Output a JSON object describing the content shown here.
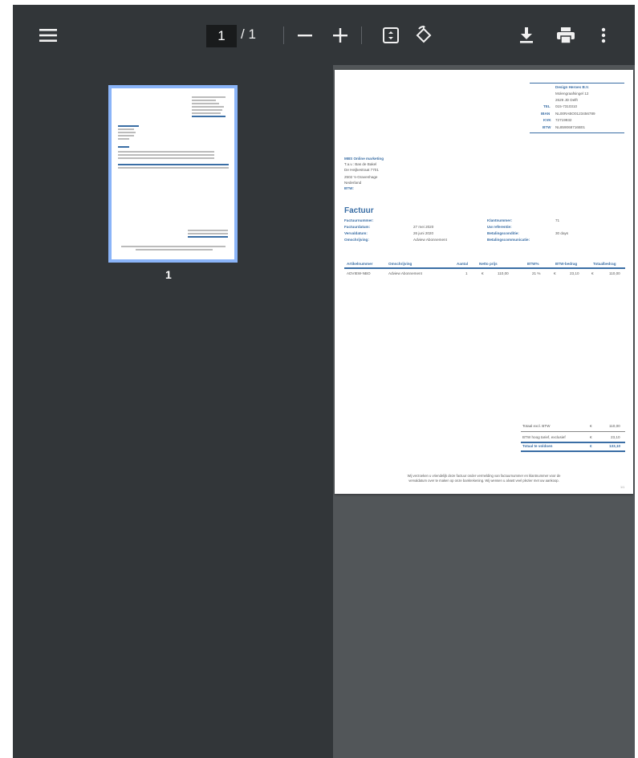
{
  "toolbar": {
    "menu_icon": "menu-icon",
    "current_page": "1",
    "total_pages": "/ 1",
    "zoom_out_icon": "minus-icon",
    "zoom_in_icon": "plus-icon",
    "fit_icon": "fit-page-icon",
    "rotate_icon": "rotate-icon",
    "download_icon": "download-icon",
    "print_icon": "print-icon",
    "more_icon": "more-vert-icon"
  },
  "sidebar": {
    "thumbnail_label": "1"
  },
  "colors": {
    "accent": "#3a6ea5",
    "toolbar": "#323639",
    "viewer_bg": "#525659",
    "thumb_border": "#8ab4f8"
  },
  "invoice": {
    "company": {
      "name": "Design Heroes B.V.",
      "address1": "Molengraafsingel 12",
      "address2": "2629 JD Delft",
      "tel_label": "TEL",
      "tel": "015-7310310",
      "iban_label": "IBAN",
      "iban": "NL00RABO0123456789",
      "kvk_label": "KVK",
      "kvk": "72719932",
      "btw_label": "BTW",
      "btw": "NL859068716B01"
    },
    "customer": {
      "name": "MBS Online marketing",
      "attn": "T.a.v.: Bas de Bakel",
      "street": "De Heijkestraat 7701",
      "city": "2502 's-Gravenhage",
      "country": "Nederland",
      "btw": "BTW:"
    },
    "title": "Factuur",
    "meta": {
      "invoice_number_label": "Factuurnummer:",
      "invoice_number": "",
      "invoice_date_label": "Factuurdatum:",
      "invoice_date": "27 mei 2020",
      "due_date_label": "Vervaldatum:",
      "due_date": "26 juni 2020",
      "description_label": "Omschrijving:",
      "description": "Adview Abonnement",
      "customer_number_label": "Klantnummer:",
      "customer_number": "71",
      "your_ref_label": "Uw referentie:",
      "your_ref": "",
      "payment_terms_label": "Betalingsconditie:",
      "payment_terms": "30 days",
      "payment_comm_label": "Betalingscommunicatie:",
      "payment_comm": ""
    },
    "table": {
      "headers": [
        "Artikelnummer",
        "Omschrijving",
        "Aantal",
        "Netto prijs",
        "BTW%",
        "BTW-bedrag",
        "Totaalbedrag"
      ],
      "rows": [
        {
          "article": "ADVIEW-NBO",
          "description": "Adview Abonnement",
          "qty": "1",
          "cur1": "€",
          "price": "110,00",
          "vat_pct": "21 %",
          "cur2": "€",
          "vat_amount": "23,10",
          "cur3": "€",
          "total": "110,00"
        }
      ]
    },
    "totals": {
      "excl_label": "Totaal excl. BTW",
      "excl_cur": "€",
      "excl_value": "110,00",
      "vat_label": "BTW hoog tarief, exclusief",
      "vat_cur": "€",
      "vat_value": "23,10",
      "due_label": "Totaal te voldoen",
      "due_cur": "€",
      "due_value": "133,10"
    },
    "footer": {
      "line1": "Wij verzoeken u vriendelijk deze factuur onder vermelding van factuurnummer en klantnummer voor de",
      "line2": "vervaldatum over te maken op onze bankrekening. Wij wensen u alvast veel plezier met uw aankoop.",
      "page_number": "1/1"
    }
  }
}
